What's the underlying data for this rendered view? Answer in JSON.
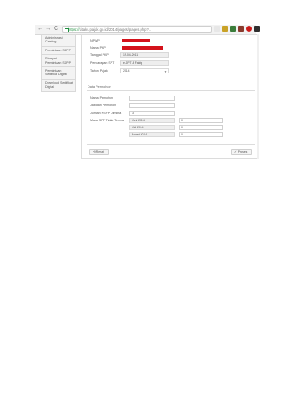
{
  "browser": {
    "back": "←",
    "forward": "→",
    "reload": "C",
    "url_scheme": "https://",
    "url_rest": "sitaks.pajak.go.id/2014/pages/pages.php?..."
  },
  "sidebar": {
    "items": [
      {
        "label": "Administrasi Catalog"
      },
      {
        "label": "Permintaan SSPP"
      },
      {
        "label": "Riwayat Permintaan SSPP"
      },
      {
        "label": "Permintaan Sertifikat Digital"
      },
      {
        "label": "Download Sertifikat Digital"
      }
    ]
  },
  "form": {
    "npwp_label": "NPWP",
    "nama_label": "Nama PKP",
    "tanggal_label": "Tanggal PKP",
    "tanggal_value": "19-04-2011",
    "pencetak_label": "Pencarapan SPT",
    "pencetak_value": "e-SPT & Faktg",
    "tahun_label": "Tahun Pajak",
    "tahun_value": "2014"
  },
  "permohonan": {
    "title": "Data Permohon",
    "nama_label": "Nama Pemohon",
    "jabatan_label": "Jabatan Pemohon",
    "jumlah_label": "Jumlah NSFP Diminta",
    "jumlah_value": "3",
    "masa_label": "Masa SPT Tidak Terima",
    "rows": [
      {
        "month": "Juni 2014",
        "value": "0"
      },
      {
        "month": "Juli 2014",
        "value": "0"
      },
      {
        "month": "Maret 2014",
        "value": "0"
      }
    ]
  },
  "buttons": {
    "reset_label": "Reset",
    "proses_label": "Proses"
  },
  "colors": {
    "redaction": "#d4121b",
    "url_green": "#1e8e3e"
  }
}
